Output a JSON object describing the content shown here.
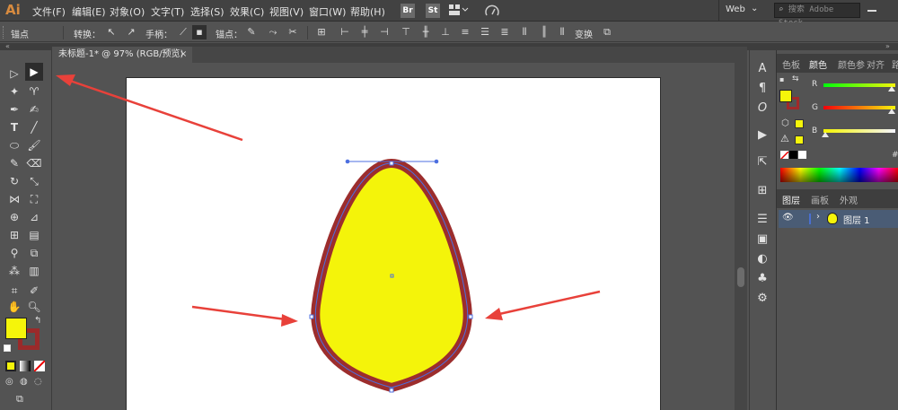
{
  "app": {
    "logo": "Ai",
    "menus": [
      "文件(F)",
      "编辑(E)",
      "对象(O)",
      "文字(T)",
      "选择(S)",
      "效果(C)",
      "视图(V)",
      "窗口(W)",
      "帮助(H)"
    ],
    "bridge_label": "Br",
    "stock_label": "St",
    "workspace": "Web",
    "search_placeholder": "搜索 Adobe Stock"
  },
  "control_bar": {
    "anchor_label": "锚点",
    "convert_label": "转换：",
    "handles_label": "手柄：",
    "anchor_points_label": "锚点：",
    "transform_label": "变换"
  },
  "document": {
    "tab_title": "未标题-1* @ 97% (RGB/预览)",
    "close_glyph": "×"
  },
  "tools": {
    "fill_color": "#f5f50a",
    "stroke_color": "#9a2a2a"
  },
  "color_panel": {
    "tabs": [
      "色板",
      "颜色",
      "颜色参",
      "对齐",
      "路"
    ],
    "active_tab": "颜色",
    "channels": [
      {
        "name": "R",
        "value": 245
      },
      {
        "name": "G",
        "value": 245
      },
      {
        "name": "B",
        "value": 10
      }
    ],
    "hash_label": "#",
    "fill_color": "#f5f50a",
    "stroke_color": "#a12a2a"
  },
  "layers_panel": {
    "tabs": [
      "图层",
      "画板",
      "外观"
    ],
    "active_tab": "图层",
    "layers": [
      {
        "name": "图层 1",
        "color": "#4a6fd0"
      }
    ]
  },
  "artwork": {
    "fill_color": "#f4f40a",
    "stroke_color": "#9c2d2d",
    "accent_arrow_color": "#e8413a"
  }
}
